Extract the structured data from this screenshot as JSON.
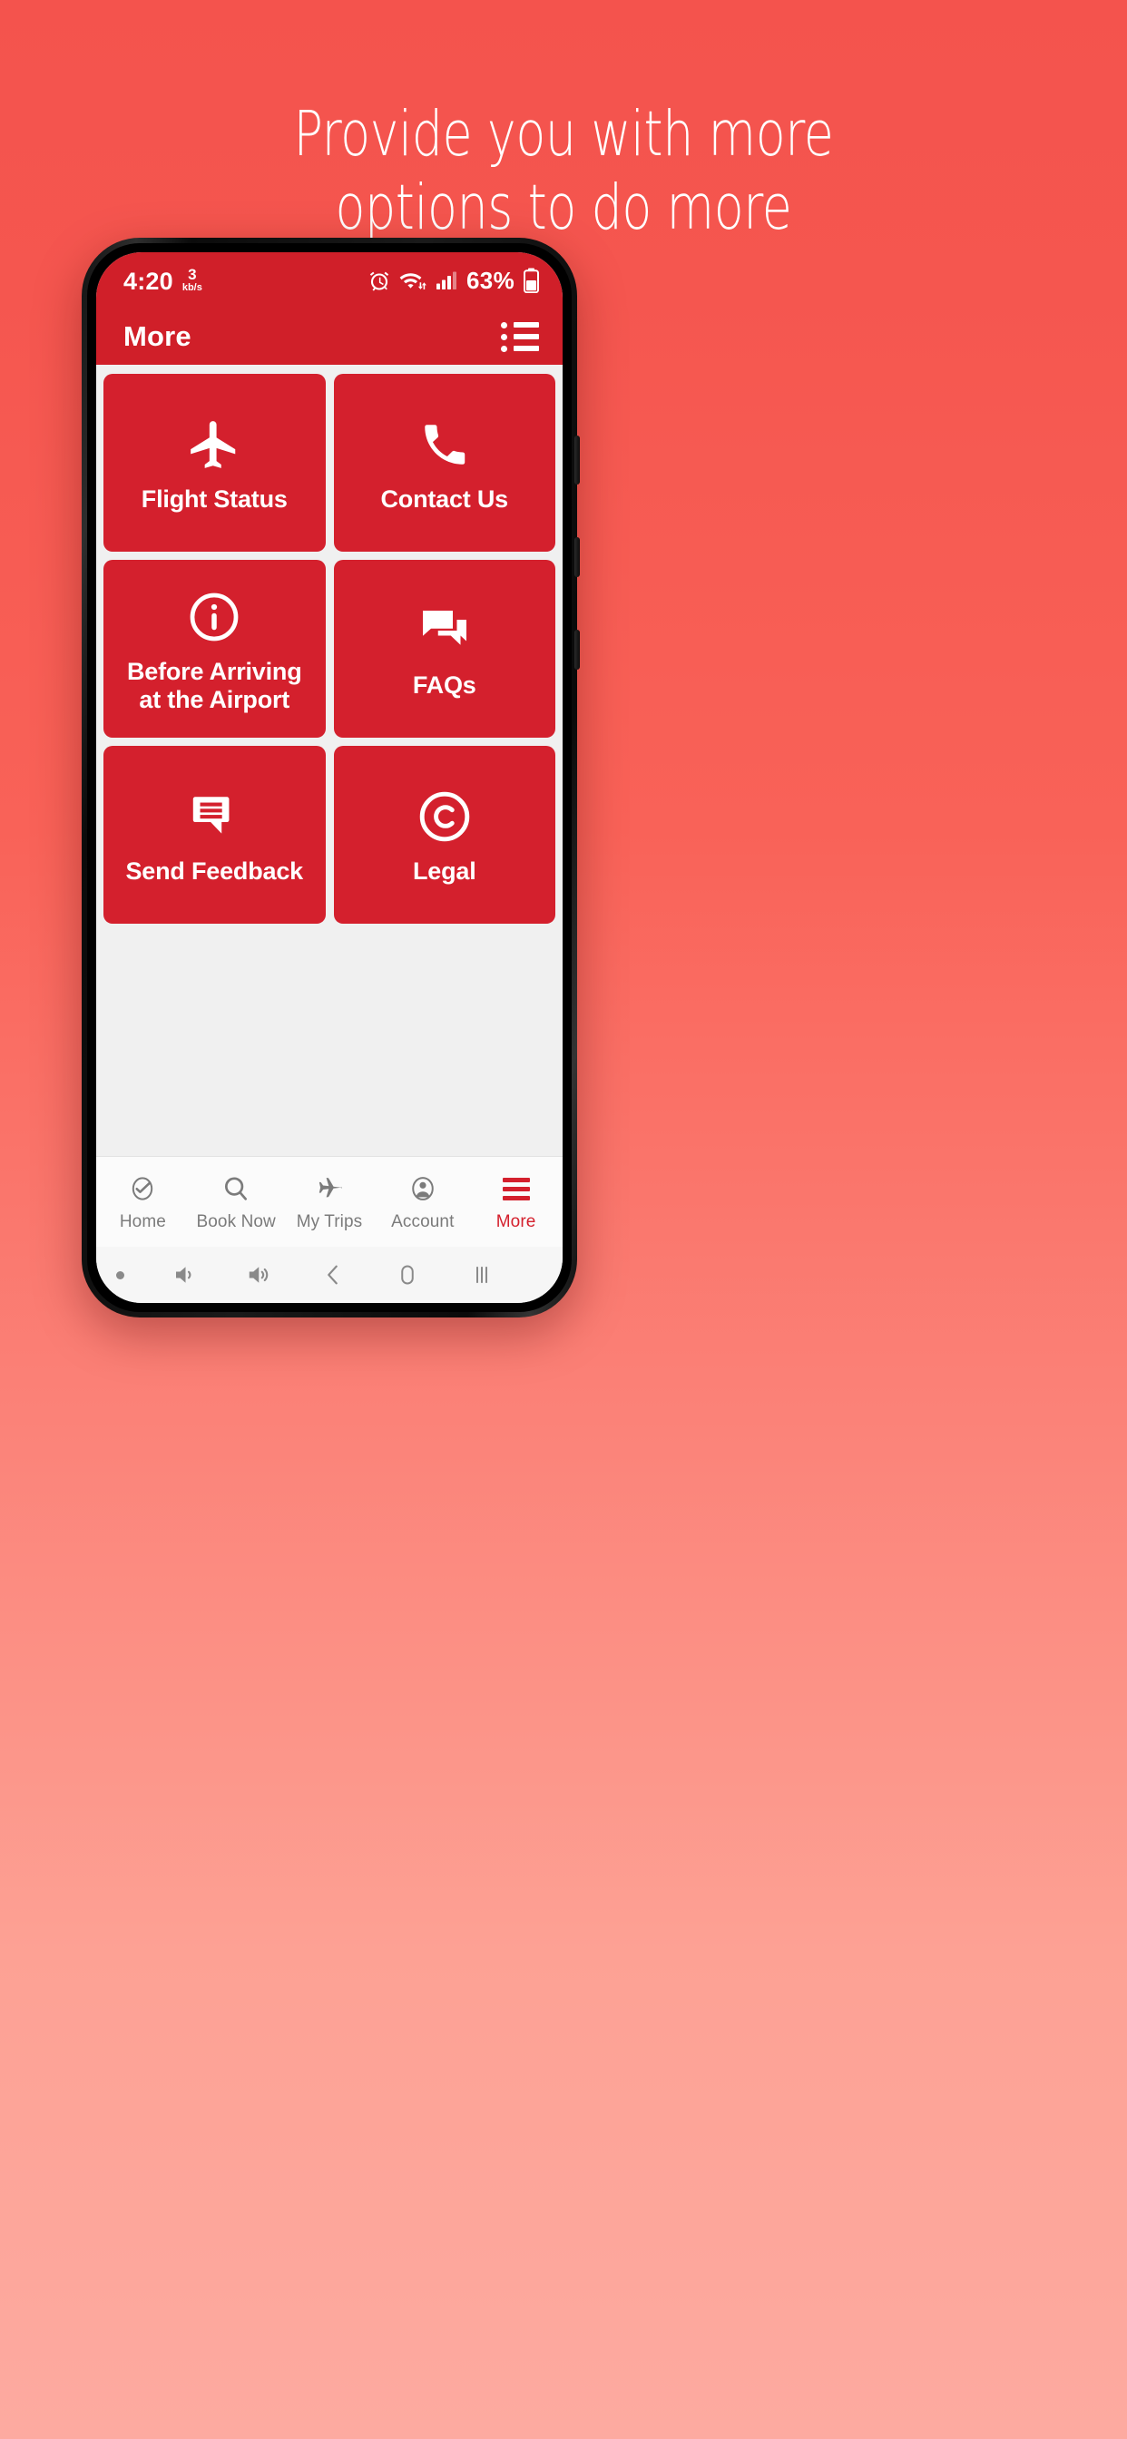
{
  "promo": {
    "line1": "Provide you with more",
    "line2": "options to do more"
  },
  "phone": {
    "statusbar": {
      "time": "4:20",
      "net_speed_value": "3",
      "net_speed_unit": "kb/s",
      "alarm_icon": "alarm-icon",
      "wifi_icon": "wifi-data-icon",
      "signal_icon": "cellular-signal-icon",
      "battery_percent": "63%",
      "battery_icon": "battery-icon"
    },
    "appbar": {
      "title": "More",
      "menu_icon": "bulleted-list-icon"
    },
    "grid": {
      "tiles": [
        {
          "label": "Flight Status",
          "icon": "airplane-icon"
        },
        {
          "label": "Contact Us",
          "icon": "phone-icon"
        },
        {
          "label": "Before Arriving at the Airport",
          "icon": "info-circle-icon"
        },
        {
          "label": "FAQs",
          "icon": "chat-bubbles-icon"
        },
        {
          "label": "Send Feedback",
          "icon": "feedback-message-icon"
        },
        {
          "label": "Legal",
          "icon": "copyright-icon"
        }
      ]
    },
    "bottom_nav": {
      "items": [
        {
          "label": "Home",
          "icon": "home-swoosh-icon",
          "active": false
        },
        {
          "label": "Book Now",
          "icon": "search-icon",
          "active": false
        },
        {
          "label": "My Trips",
          "icon": "airplane-icon",
          "active": false
        },
        {
          "label": "Account",
          "icon": "account-person-icon",
          "active": false
        },
        {
          "label": "More",
          "icon": "hamburger-icon",
          "active": true
        }
      ]
    },
    "android_nav": {
      "items": [
        "indicator-dot",
        "volume-down-icon",
        "volume-up-icon",
        "back-icon",
        "home-icon",
        "recents-icon"
      ]
    }
  },
  "colors": {
    "background_top": "#f4534d",
    "background_bottom": "#fdaaa0",
    "brand_red": "#d4202d",
    "statusbar_red": "#d01f29",
    "tile_red": "#d4202d",
    "content_bg": "#f0f0f0",
    "nav_inactive": "#7b7b7b"
  }
}
